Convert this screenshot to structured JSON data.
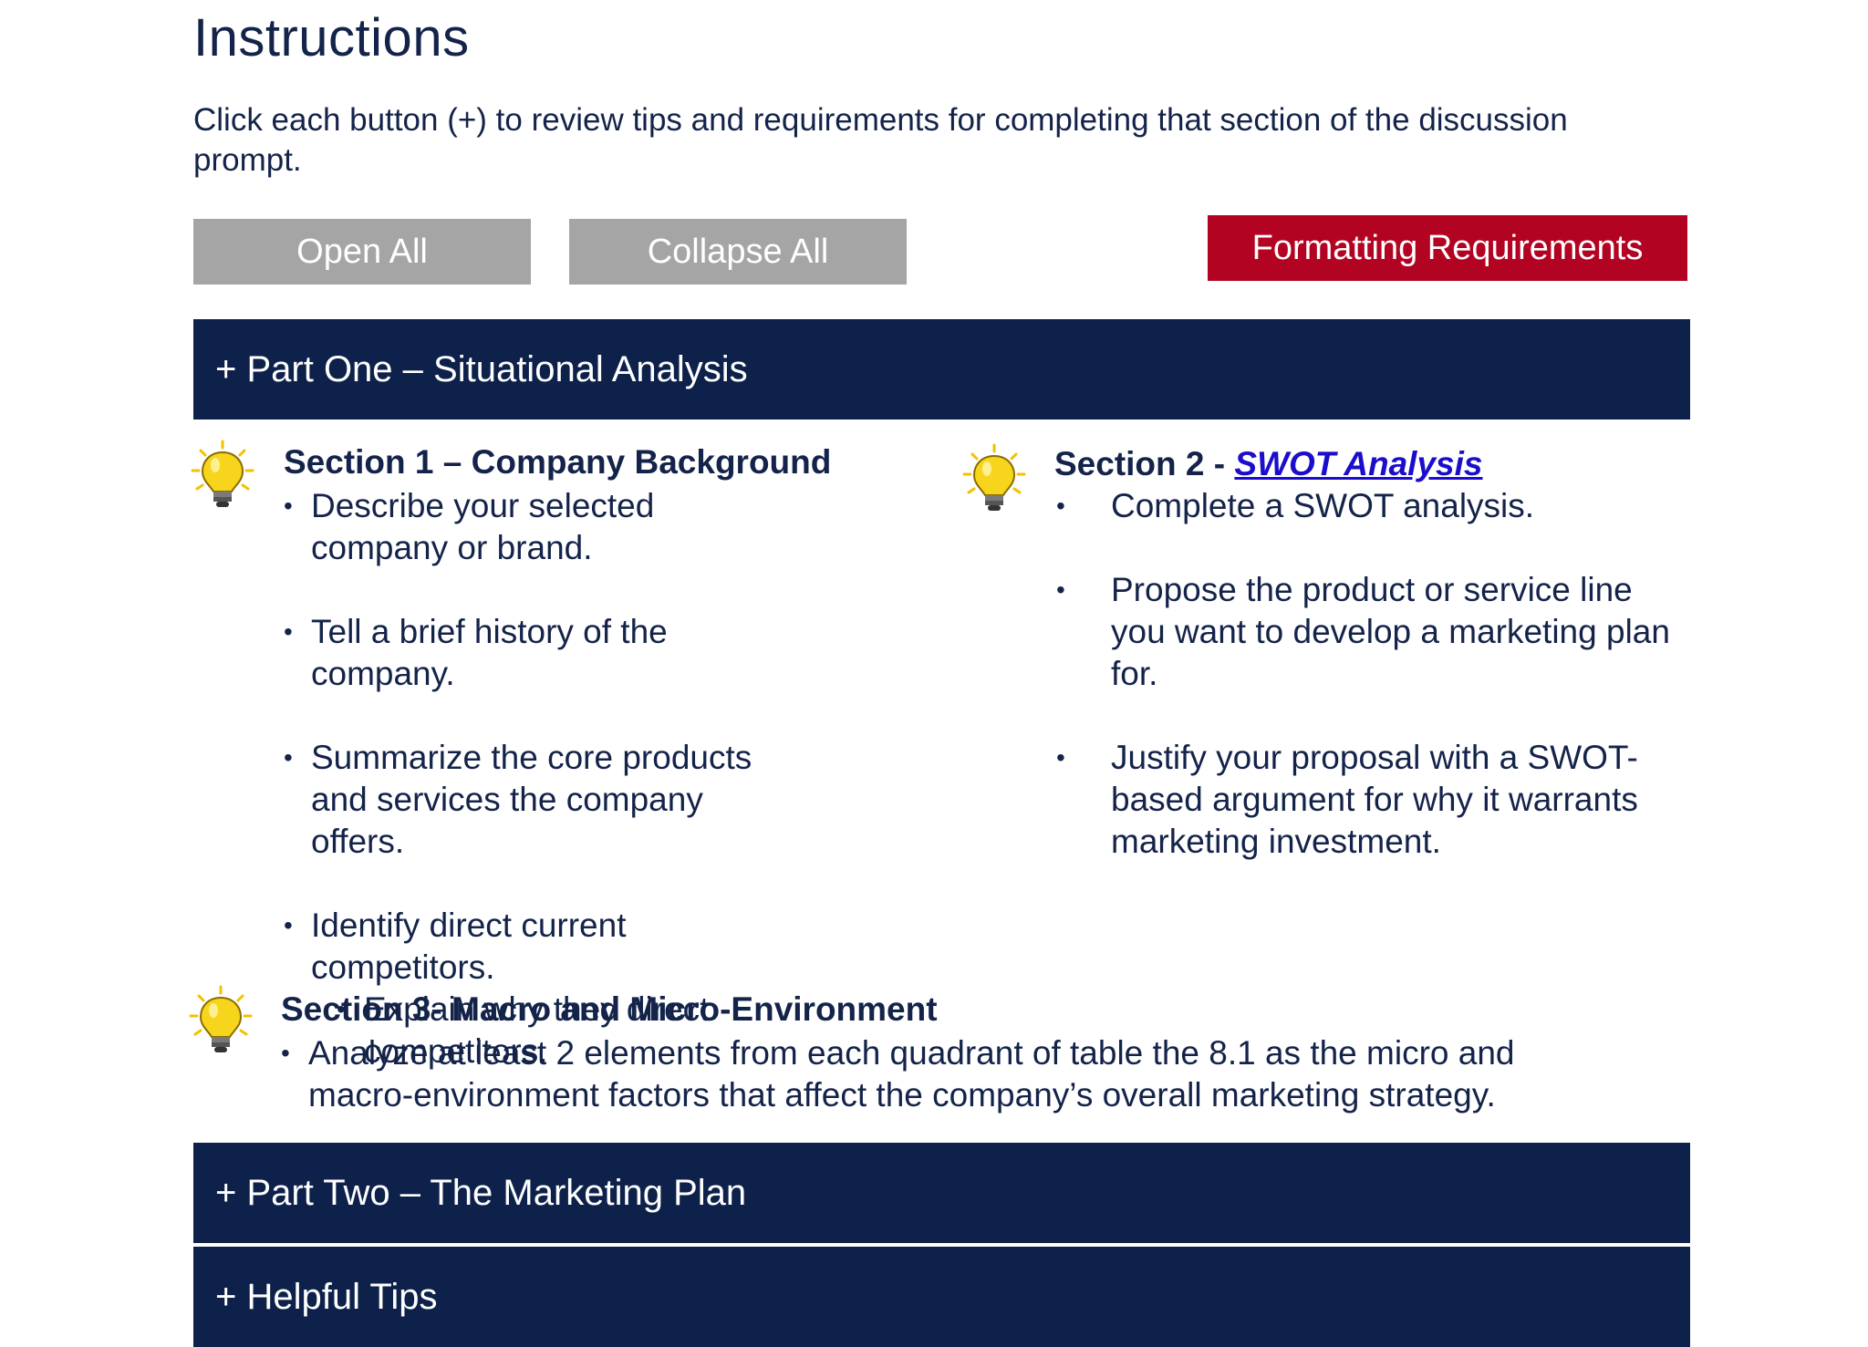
{
  "header": {
    "title": "Instructions",
    "intro": "Click each button (+) to review tips and requirements for completing that section of the discussion prompt."
  },
  "buttons": {
    "open_all": "Open All",
    "collapse_all": "Collapse All",
    "formatting": "Formatting Requirements"
  },
  "accordions": [
    {
      "label": "+ Part One – Situational Analysis",
      "expanded": true
    },
    {
      "label": "+ Part Two –  The Marketing Plan",
      "expanded": false
    },
    {
      "label": "+ Helpful Tips",
      "expanded": false
    }
  ],
  "sections": {
    "s1": {
      "heading": "Section 1  – Company Background",
      "items": [
        "Describe your selected company or brand.",
        "Tell a brief history of the company.",
        "Summarize the core products and services the company offers.",
        "Identify direct current competitors."
      ],
      "sub_item": "Explain why they direct competitors."
    },
    "s2": {
      "heading_prefix": "Section 2 - ",
      "heading_link": "SWOT Analysis",
      "items": [
        "Complete a SWOT analysis.",
        "Propose the product or service line you want to develop a marketing plan for.",
        "Justify your proposal with a SWOT-based argument for why it warrants marketing investment."
      ]
    },
    "s3": {
      "heading": "Section 3- Macro and Micro-Environment",
      "items": [
        "Analyze at least 2 elements from each quadrant of table the 8.1 as the micro and macro-environment factors that affect the company’s overall marketing strategy."
      ]
    }
  },
  "icons": {
    "tip": "lightbulb-icon"
  },
  "colors": {
    "navy": "#0d214a",
    "text": "#14234a",
    "gray_button": "#a5a5a5",
    "red_button": "#b30322",
    "link": "#1a0dcc",
    "bulb": "#f7d51d"
  }
}
